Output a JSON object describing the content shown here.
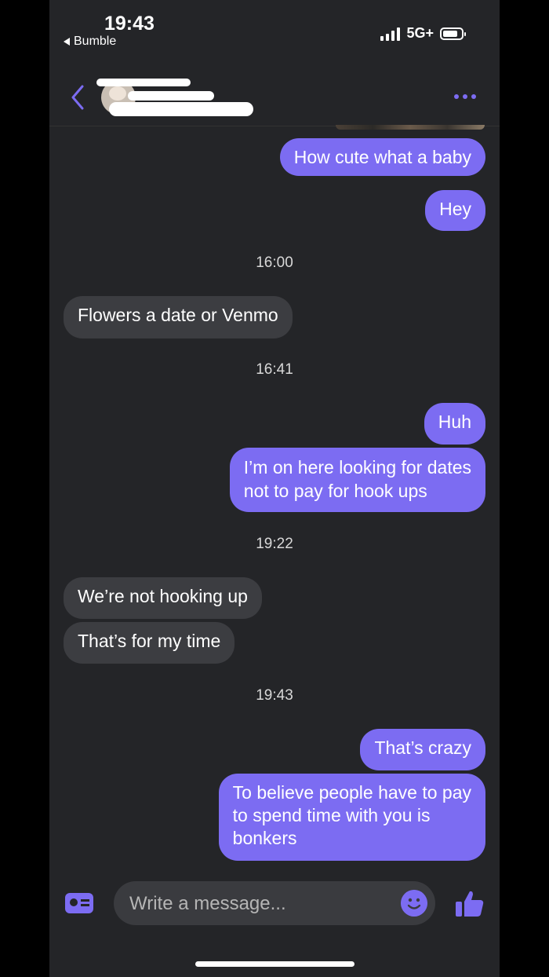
{
  "status_bar": {
    "time": "19:43",
    "back_app": "Bumble",
    "network": "5G+"
  },
  "header": {
    "back_icon": "chevron-left-icon",
    "more_icon": "more-dots-icon"
  },
  "messages": [
    {
      "side": "out",
      "text": "How cute what a baby"
    },
    {
      "side": "out",
      "text": "Hey"
    },
    {
      "timestamp": "16:00"
    },
    {
      "side": "in",
      "text": "Flowers a date or Venmo"
    },
    {
      "timestamp": "16:41"
    },
    {
      "side": "out",
      "text": "Huh"
    },
    {
      "side": "out",
      "text": "I’m on here looking for dates\nnot to pay for hook ups"
    },
    {
      "timestamp": "19:22"
    },
    {
      "side": "in",
      "text": "We’re not hooking up"
    },
    {
      "side": "in",
      "text": "That’s for my time"
    },
    {
      "timestamp": "19:43"
    },
    {
      "side": "out",
      "text": "That’s crazy"
    },
    {
      "side": "out",
      "text": "To believe people have to pay\nto spend time with you is\nbonkers"
    }
  ],
  "composer": {
    "placeholder": "Write a message...",
    "profile_icon": "profile-card-icon",
    "emoji_icon": "emoji-icon",
    "like_icon": "thumbs-up-icon"
  },
  "colors": {
    "accent": "#7c6cf2",
    "background": "#242528",
    "incoming_bubble": "#3c3d41"
  }
}
